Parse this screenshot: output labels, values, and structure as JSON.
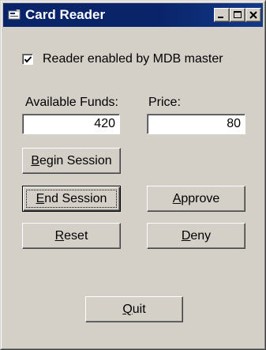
{
  "window": {
    "title": "Card Reader"
  },
  "title_buttons": {
    "minimize_icon": "minimize-icon",
    "maximize_icon": "maximize-icon",
    "close_icon": "close-icon"
  },
  "reader": {
    "checked": true,
    "label": "Reader enabled by MDB master"
  },
  "funds": {
    "label": "Available Funds:",
    "value": "420"
  },
  "price": {
    "label": "Price:",
    "value": "80"
  },
  "buttons": {
    "begin_session": {
      "mnemonic": "B",
      "rest": "egin Session"
    },
    "end_session": {
      "mnemonic": "E",
      "rest": "nd Session"
    },
    "approve": {
      "mnemonic": "A",
      "rest": "pprove"
    },
    "reset": {
      "mnemonic": "R",
      "rest": "eset"
    },
    "deny": {
      "mnemonic": "D",
      "rest": "eny"
    },
    "quit": {
      "mnemonic": "Q",
      "rest": "uit"
    }
  },
  "colors": {
    "title_bar": "#0a246a",
    "window_face": "#d4d0c8",
    "field_background": "#ffffff"
  }
}
